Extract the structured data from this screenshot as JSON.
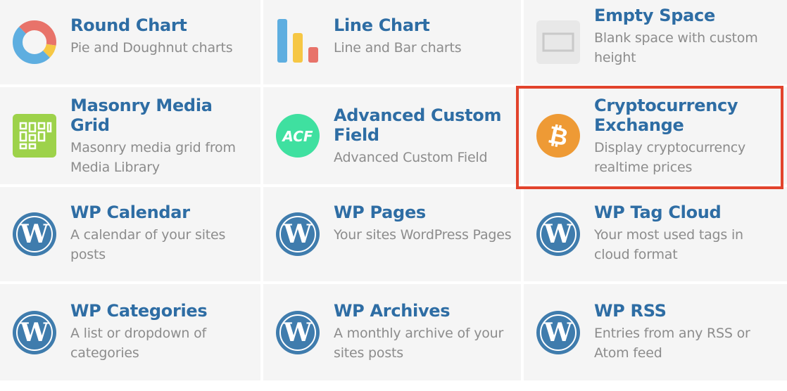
{
  "elements": [
    {
      "title": "Round Chart",
      "desc": "Pie and Doughnut charts",
      "icon": "round-chart"
    },
    {
      "title": "Line Chart",
      "desc": "Line and Bar charts",
      "icon": "line-chart"
    },
    {
      "title": "Empty Space",
      "desc": "Blank space with custom height",
      "icon": "empty-space"
    },
    {
      "title": "Masonry Media Grid",
      "desc": "Masonry media grid from Media Library",
      "icon": "masonry-grid"
    },
    {
      "title": "Advanced Custom Field",
      "desc": "Advanced Custom Field",
      "icon": "acf",
      "icon_text": "ACF"
    },
    {
      "title": "Cryptocurrency Exchange",
      "desc": "Display cryptocurrency realtime prices",
      "icon": "bitcoin",
      "icon_text": "₿"
    },
    {
      "title": "WP Calendar",
      "desc": "A calendar of your sites posts",
      "icon": "wordpress",
      "icon_text": "W"
    },
    {
      "title": "WP Pages",
      "desc": "Your sites WordPress Pages",
      "icon": "wordpress",
      "icon_text": "W"
    },
    {
      "title": "WP Tag Cloud",
      "desc": "Your most used tags in cloud format",
      "icon": "wordpress",
      "icon_text": "W"
    },
    {
      "title": "WP Categories",
      "desc": "A list or dropdown of categories",
      "icon": "wordpress",
      "icon_text": "W"
    },
    {
      "title": "WP Archives",
      "desc": "A monthly archive of your sites posts",
      "icon": "wordpress",
      "icon_text": "W"
    },
    {
      "title": "WP RSS",
      "desc": "Entries from any RSS or Atom feed",
      "icon": "wordpress",
      "icon_text": "W"
    }
  ]
}
